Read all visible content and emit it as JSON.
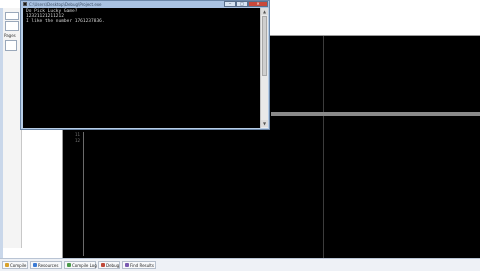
{
  "ide": {
    "left_panel_button_label": "Pages"
  },
  "gutter": {
    "line_numbers": [
      "11",
      "12"
    ]
  },
  "console": {
    "title": "C:\\Users\\Desktop\\Debug\\Project.exe",
    "lines": [
      "Do Pick Lucky Game?",
      "12321121211212",
      "I like the number 1761237836."
    ],
    "close_glyph": "✕",
    "max_glyph": "□",
    "min_glyph": "‒"
  },
  "tabs": [
    {
      "label": "Compile",
      "icon_color": "#d8a12a"
    },
    {
      "label": "Resources",
      "icon_color": "#3a7bd5"
    },
    {
      "label": "Compile Log",
      "icon_color": "#4a9a4a"
    },
    {
      "label": "Debug",
      "icon_color": "#c04a3a"
    },
    {
      "label": "Find Results",
      "icon_color": "#7a5ab0"
    }
  ]
}
